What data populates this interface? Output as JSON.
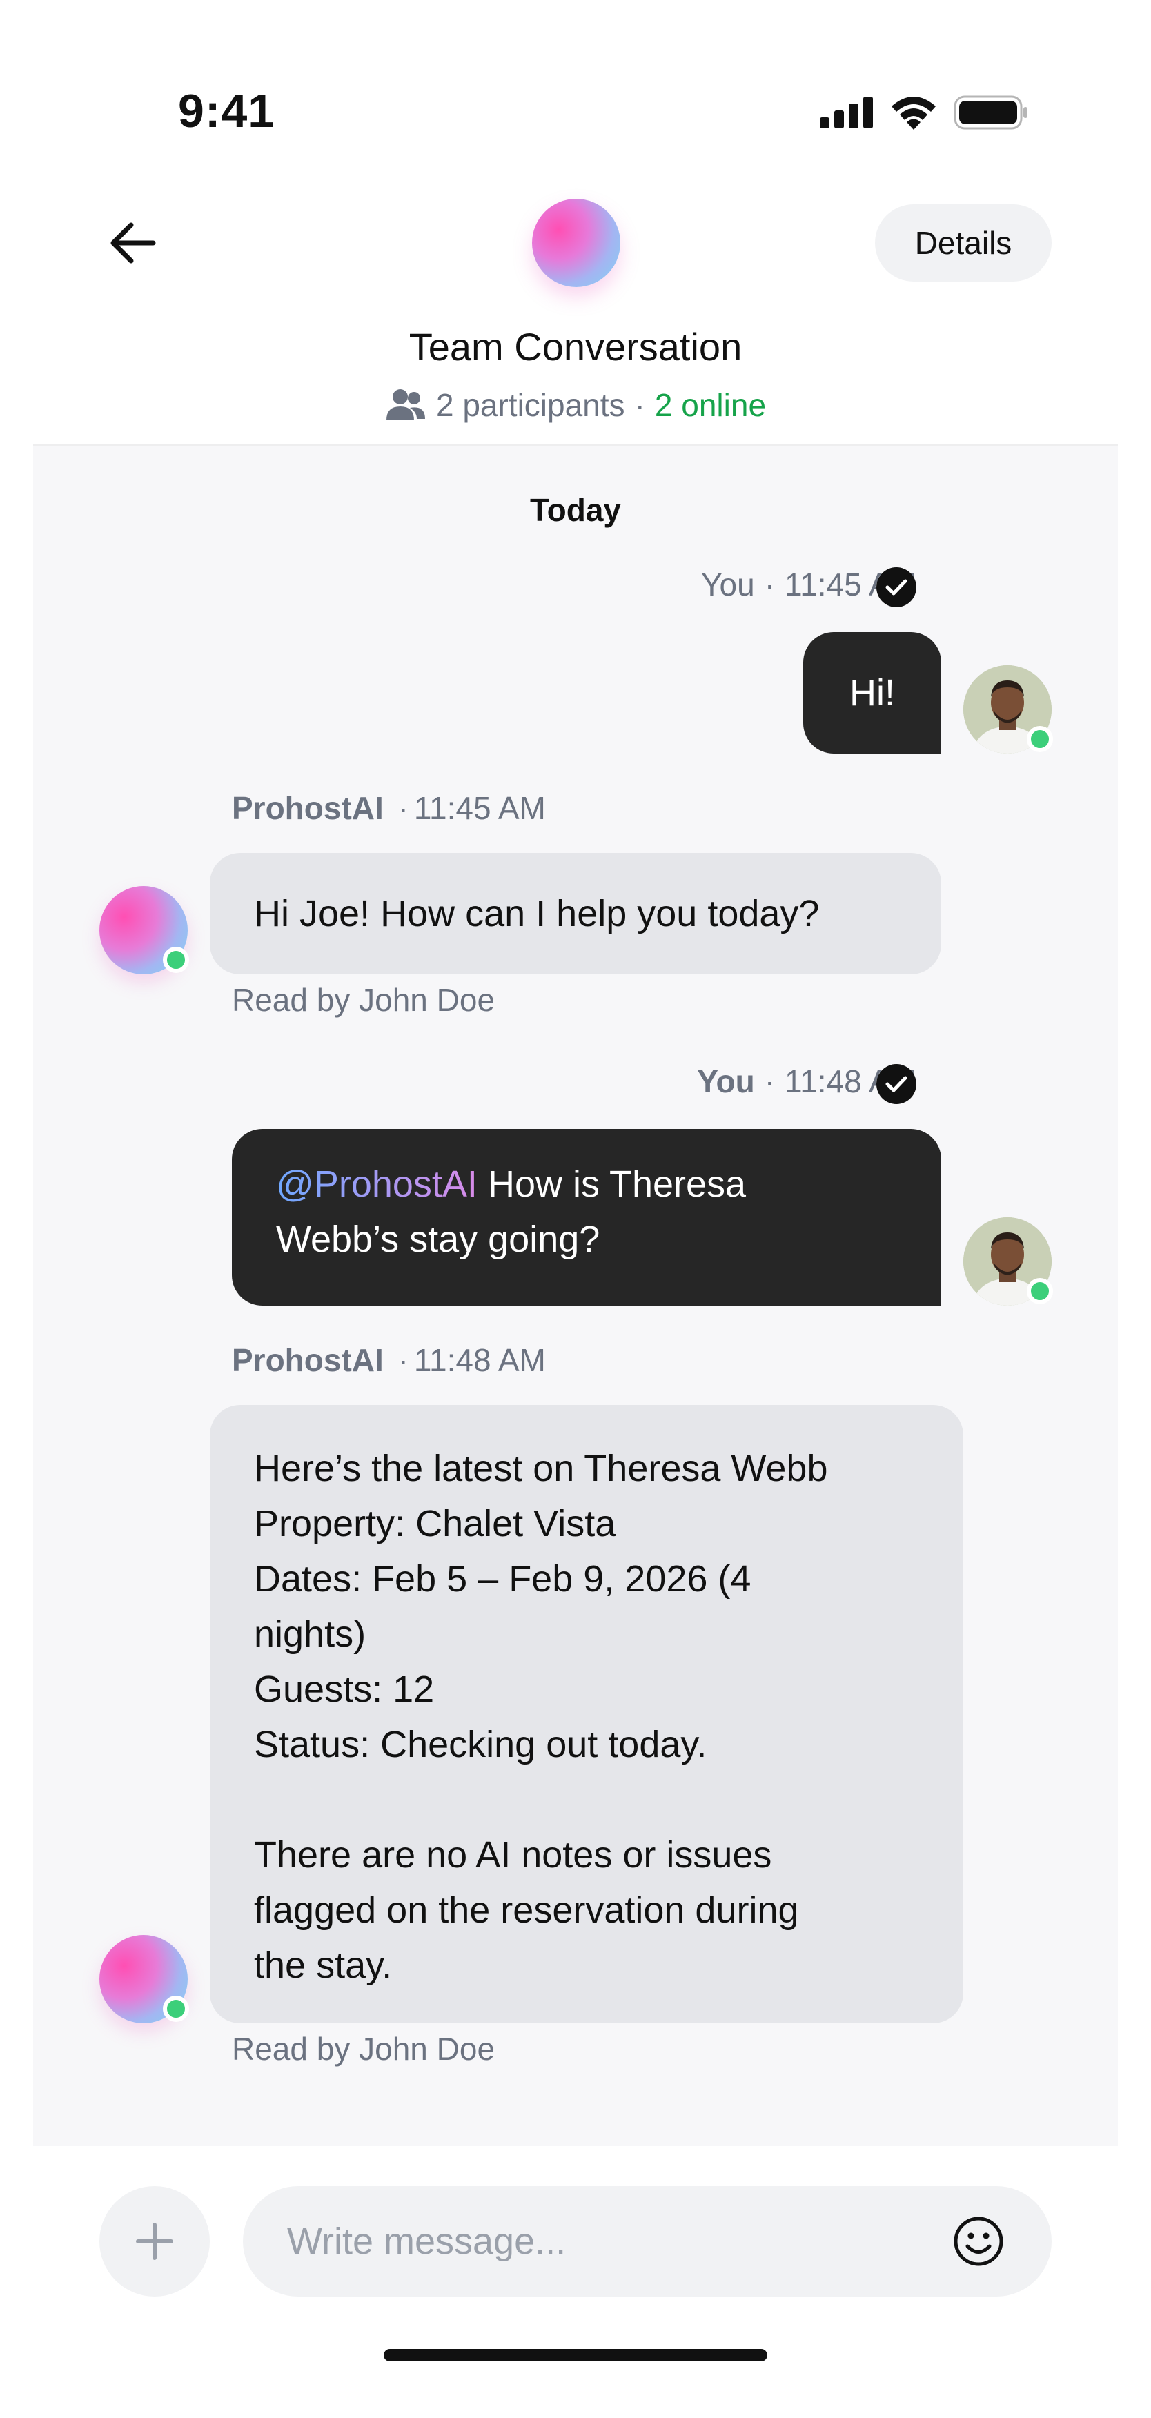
{
  "status_bar": {
    "time": "9:41",
    "icons": [
      "cellular-signal-icon",
      "wifi-icon",
      "battery-icon"
    ]
  },
  "header": {
    "back_icon": "arrow-left-icon",
    "title": "Team Conversation",
    "participants_icon": "people-icon",
    "participants": "2 participants",
    "separator": "·",
    "online": "2 online",
    "details_label": "Details"
  },
  "chat": {
    "day_label": "Today",
    "messages": [
      {
        "sender": "You",
        "sep": "·",
        "time": "11:45 AM",
        "text": "Hi!"
      },
      {
        "sender": "ProhostAI",
        "sep": "·",
        "time": "11:45 AM",
        "text": "Hi Joe! How can I help you today?",
        "read_by": "Read by John Doe"
      },
      {
        "sender": "You",
        "sep": "·",
        "time": "11:48 AM",
        "mention": "@ProhostAI",
        "text_line1": " How is Theresa",
        "text_line2": "Webb’s stay going?"
      },
      {
        "sender": "ProhostAI",
        "sep": "·",
        "time": "11:48 AM",
        "lines": [
          "Here’s the latest on Theresa Webb",
          "Property: Chalet Vista",
          "Dates: Feb 5 – Feb 9, 2026 (4",
          "nights)",
          "Guests: 12",
          "Status: Checking out today.",
          "",
          "There are no AI notes or issues",
          "flagged on the reservation during",
          "the stay."
        ],
        "read_by": "Read by John Doe"
      }
    ]
  },
  "composer": {
    "placeholder": "Write message...",
    "value": "",
    "plus_icon": "plus-icon",
    "emoji_icon": "smiley-icon"
  },
  "colors": {
    "online": "#16a34a",
    "dark_bubble": "#262626",
    "light_bubble": "#e5e6ea",
    "accent_dot": "#3ccf7a"
  }
}
